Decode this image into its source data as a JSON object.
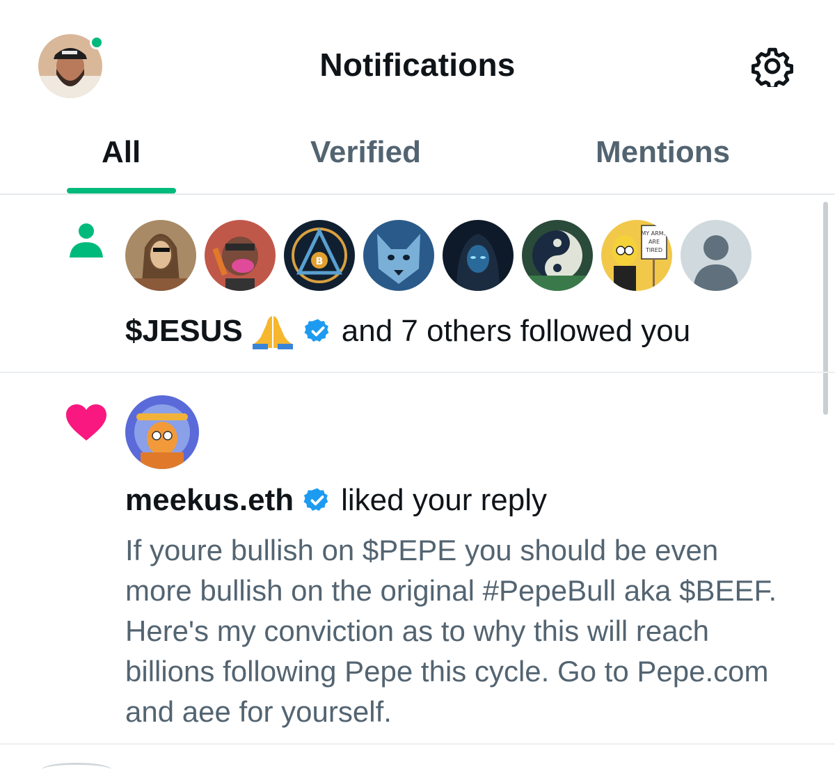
{
  "header": {
    "title": "Notifications",
    "avatar_icon": "user-avatar",
    "settings_icon": "gear-icon"
  },
  "tabs": [
    {
      "label": "All",
      "active": true
    },
    {
      "label": "Verified",
      "active": false
    },
    {
      "label": "Mentions",
      "active": false
    }
  ],
  "colors": {
    "accent": "#00ba7c",
    "like": "#f91880",
    "verified": "#1d9bf0",
    "secondary_text": "#536471"
  },
  "notifications": [
    {
      "type": "follow",
      "icon": "person-icon",
      "name": "$JESUS",
      "emoji": "🙏",
      "verified": true,
      "text": "and 7 others followed you",
      "avatars": [
        "jesus-avatar",
        "ape-avatar",
        "bitcoin-mason-avatar",
        "wolf-avatar",
        "hooded-figure-avatar",
        "yin-yang-avatar",
        "cartoon-sign-avatar",
        "default-avatar"
      ],
      "sign_text": "MY ARMS ARE TIRED"
    },
    {
      "type": "like",
      "icon": "heart-icon",
      "name": "meekus.eth",
      "verified": true,
      "action": "liked your reply",
      "text_lines": [
        "If youre bullish on $PEPE you should be even",
        "more bullish on the original #PepeBull aka $BEEF.",
        "Here's my conviction as to why this will reach",
        "billions following Pepe this cycle. Go to Pepe.com",
        "and aee for yourself."
      ]
    }
  ]
}
